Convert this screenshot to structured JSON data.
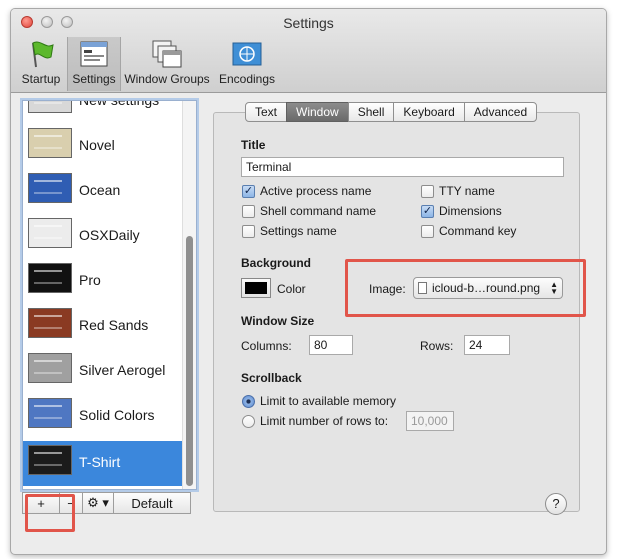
{
  "window": {
    "title": "Settings"
  },
  "toolbar": {
    "items": [
      {
        "label": "Startup",
        "icon": "flag-icon"
      },
      {
        "label": "Settings",
        "icon": "settings-window-icon"
      },
      {
        "label": "Window Groups",
        "icon": "window-groups-icon"
      },
      {
        "label": "Encodings",
        "icon": "un-flag-icon"
      }
    ]
  },
  "profiles": [
    {
      "label": "New settings",
      "thumb_color": "#d8d8d8"
    },
    {
      "label": "Novel",
      "thumb_color": "#d9cfae"
    },
    {
      "label": "Ocean",
      "thumb_color": "#2f5db3"
    },
    {
      "label": "OSXDaily",
      "thumb_color": "#ececec"
    },
    {
      "label": "Pro",
      "thumb_color": "#111111"
    },
    {
      "label": "Red Sands",
      "thumb_color": "#8a3a22"
    },
    {
      "label": "Silver Aerogel",
      "thumb_color": "#a0a0a0"
    },
    {
      "label": "Solid Colors",
      "thumb_color": "#4f77c2"
    },
    {
      "label": "T-Shirt",
      "thumb_color": "#1b1b1b"
    }
  ],
  "bottom_bar": {
    "add": "+",
    "remove": "−",
    "gear": "⚙ ▾",
    "default": "Default"
  },
  "tabs": [
    "Text",
    "Window",
    "Shell",
    "Keyboard",
    "Advanced"
  ],
  "title_section": {
    "label": "Title",
    "value": "Terminal",
    "checkboxes": [
      {
        "label": "Active process name",
        "checked": true
      },
      {
        "label": "TTY name",
        "checked": false
      },
      {
        "label": "Shell command name",
        "checked": false
      },
      {
        "label": "Dimensions",
        "checked": true
      },
      {
        "label": "Settings name",
        "checked": false
      },
      {
        "label": "Command key",
        "checked": false
      }
    ]
  },
  "background_section": {
    "label": "Background",
    "color_label": "Color",
    "image_label": "Image:",
    "image_value": "icloud-b…round.png"
  },
  "window_size": {
    "label": "Window Size",
    "columns_label": "Columns:",
    "columns_value": "80",
    "rows_label": "Rows:",
    "rows_value": "24"
  },
  "scrollback": {
    "label": "Scrollback",
    "option_available": "Limit to available memory",
    "option_rows": "Limit number of rows to:",
    "rows_placeholder": "10,000"
  },
  "help": "?",
  "colors": {
    "accent": "#3b87dc",
    "highlight": "#e1554a"
  }
}
